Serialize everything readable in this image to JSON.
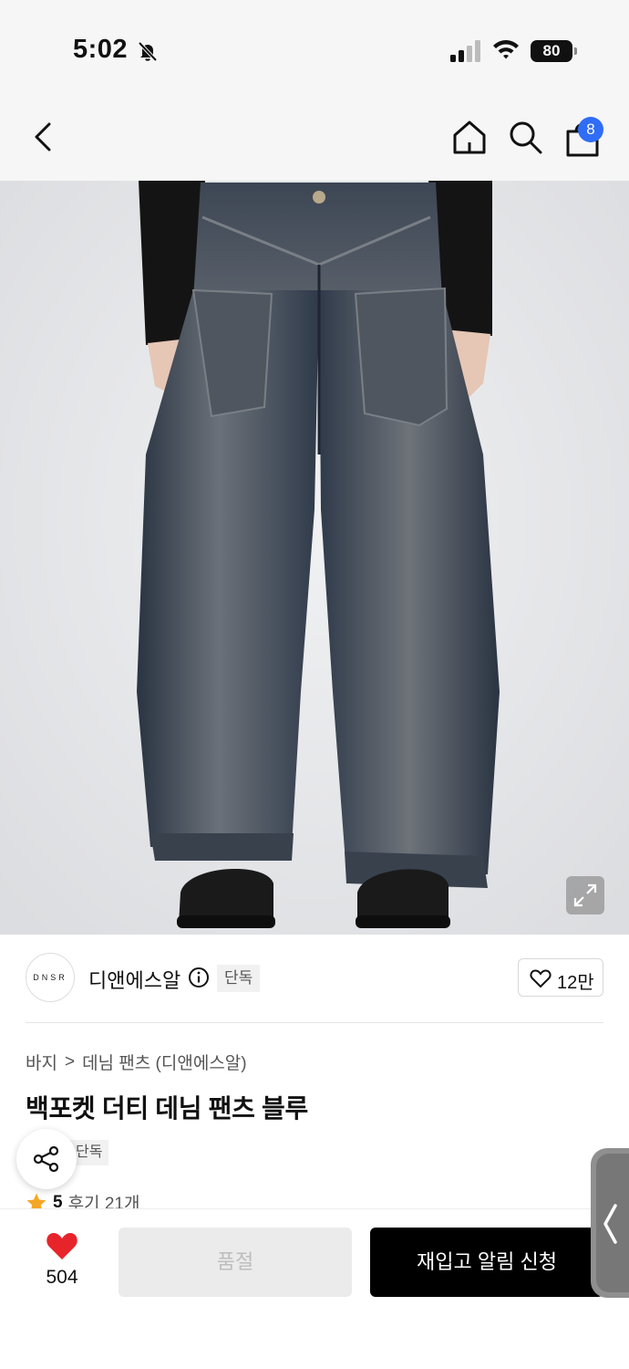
{
  "status_bar": {
    "time": "5:02",
    "battery": "80"
  },
  "header": {
    "back_icon": "chevron-left-icon",
    "home_icon": "home-icon",
    "search_icon": "search-icon",
    "cart_icon": "shopping-bag-icon",
    "cart_count": "8",
    "badge_color": "#2f6df6"
  },
  "product": {
    "image_alt": "wide-leg washed denim pants",
    "brand_logo_text": "DNSR",
    "brand_name": "디앤에스알",
    "exclusive_tag": "단독",
    "likes": "12만",
    "breadcrumb": {
      "category": "바지",
      "separator": ">",
      "subcategory": "데님 팬츠 (디앤에스알)"
    },
    "title": "백포켓 더티 데님 팬츠 블루",
    "tag": "단독",
    "rating": {
      "score": "5",
      "reviews": "후기 21개",
      "star_color": "#f5a623"
    }
  },
  "bottom_bar": {
    "wish_count": "504",
    "heart_color": "#e8242b",
    "soldout_label": "품절",
    "restock_label": "재입고 알림 신청"
  }
}
